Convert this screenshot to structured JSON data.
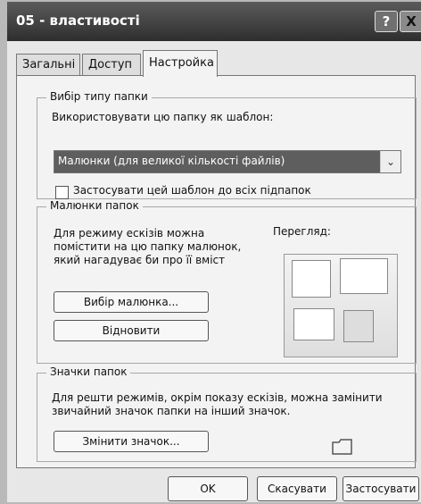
{
  "window": {
    "title": "05 - властивості",
    "help_label": "?",
    "close_label": "X"
  },
  "tabs": [
    {
      "label": "Загальні"
    },
    {
      "label": "Доступ"
    },
    {
      "label": "Настройка"
    }
  ],
  "folder_type": {
    "legend": "Вибір типу папки",
    "use_label": "Використовувати цю папку як шаблон:",
    "selected": "Малюнки (для великої кількості файлів)",
    "apply_label": "Застосувати цей шаблон до всіх підпапок"
  },
  "folder_pictures": {
    "legend": "Малюнки папок",
    "description_1": "Для режиму ескізів можна",
    "description_2": "помістити на цю папку малюнок,",
    "description_3": "який нагадуває би про її вміст",
    "preview_label": "Перегляд:",
    "choose_button": "Вибір малюнка...",
    "restore_button": "Відновити"
  },
  "folder_icons": {
    "legend": "Значки папок",
    "description_1": "Для решти режимів, окрім показу ескізів, можна замінити",
    "description_2": "звичайний значок папки на інший значок.",
    "change_button": "Змінити значок..."
  },
  "buttons": {
    "ok": "OK",
    "cancel": "Скасувати",
    "apply": "Застосувати"
  }
}
